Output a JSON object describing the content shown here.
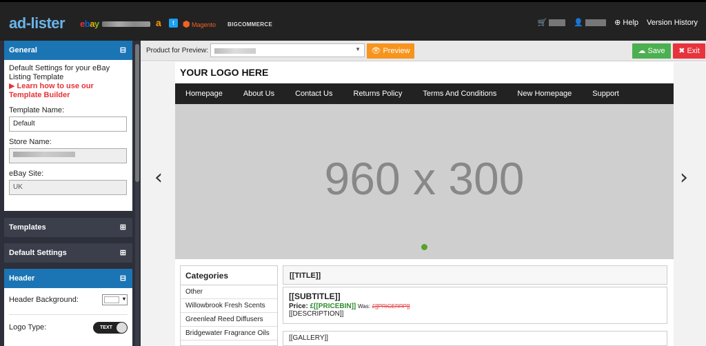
{
  "brand": {
    "logo_a": "ad",
    "logo_b": "-",
    "logo_c": "lister",
    "ebay_e": "e",
    "ebay_b": "b",
    "ebay_a": "a",
    "ebay_y": "y",
    "amazon": "a",
    "twitter": "t",
    "magento": "Magento",
    "bigcommerce": "BIGCOMMERCE"
  },
  "topnav": {
    "help": "Help",
    "version_history": "Version History"
  },
  "sidebar": {
    "general": {
      "title": "General",
      "toggle": "⊟",
      "desc": "Default Settings for your eBay Listing Template",
      "learn_link": "Learn how to use our Template Builder",
      "template_name_label": "Template Name:",
      "template_name_value": "Default",
      "store_name_label": "Store Name:",
      "ebay_site_label": "eBay Site:",
      "ebay_site_value": "UK"
    },
    "templates": {
      "title": "Templates",
      "toggle": "⊞"
    },
    "default_settings": {
      "title": "Default Settings",
      "toggle": "⊞"
    },
    "header": {
      "title": "Header",
      "toggle": "⊟",
      "bg_label": "Header Background:",
      "logo_type_label": "Logo Type:",
      "logo_type_value": "TEXT"
    }
  },
  "toolbar": {
    "product_label": "Product for Preview:",
    "preview": "Preview",
    "save": "Save",
    "exit": "Exit"
  },
  "canvas": {
    "logo_text": "YOUR LOGO HERE",
    "menu": [
      "Homepage",
      "About Us",
      "Contact Us",
      "Returns Policy",
      "Terms And Conditions",
      "New Homepage",
      "Support"
    ],
    "slider_text": "960 x 300",
    "categories_title": "Categories",
    "categories": [
      "Other",
      "Willowbrook Fresh Scents",
      "Greenleaf Reed Diffusers",
      "Bridgewater Fragrance Oils"
    ],
    "title_token": "[[TITLE]]",
    "subtitle_token": "[[SUBTITLE]]",
    "price_label": "Price:",
    "price_token": "£[[PRICEBIN]]",
    "was_label": "Was:",
    "was_token": "£[[PRICERRP]]",
    "description_token": "[[DESCRIPTION]]",
    "gallery_token": "[[GALLERY]]"
  },
  "colors": {
    "accent_blue": "#1b75b4",
    "orange": "#f7941d",
    "green": "#4cb050",
    "red": "#e8333c"
  }
}
